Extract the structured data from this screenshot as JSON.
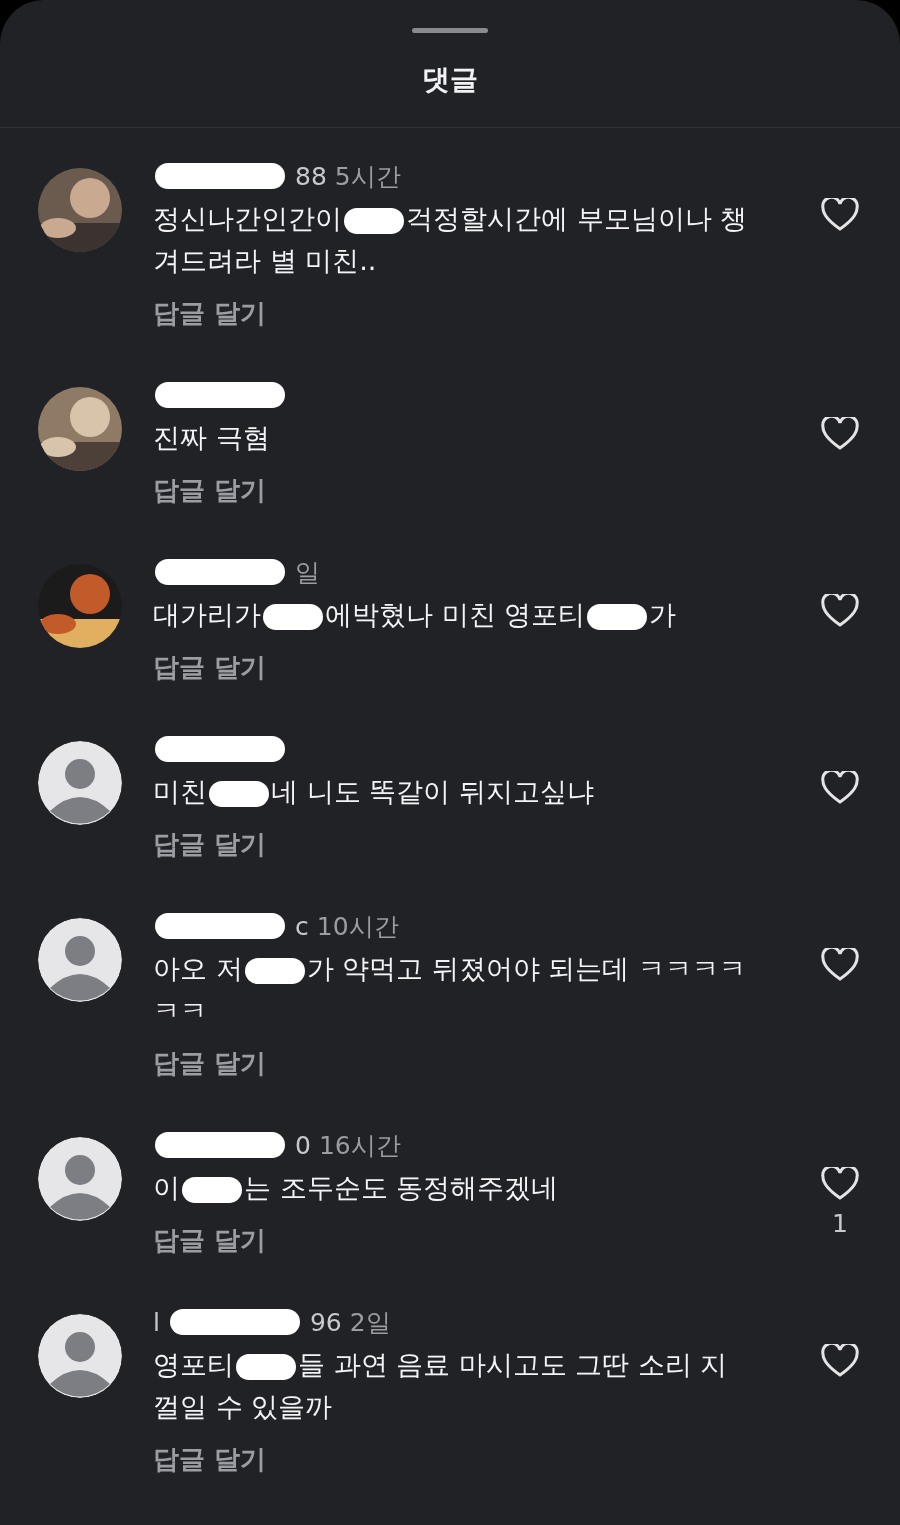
{
  "sheet": {
    "title": "댓글"
  },
  "comments": [
    {
      "user": [
        {
          "kind": "hidden"
        },
        {
          "kind": "text",
          "text": "88"
        }
      ],
      "time": "5시간",
      "text": [
        "정신나간인간이",
        "걱정할시간에 부모님이나 챙겨드려라 별 미친.."
      ],
      "reply": "답글 달기",
      "liked": false
    },
    {
      "user": [
        {
          "kind": "hidden"
        }
      ],
      "text": [
        "진짜 극혐"
      ],
      "reply": "답글 달기",
      "liked": false
    },
    {
      "user": [
        {
          "kind": "hidden"
        }
      ],
      "time": "일",
      "text": [
        "대가리가",
        "에박혔나 미친 영포티",
        "가"
      ],
      "reply": "답글 달기",
      "liked": false
    },
    {
      "kind": "default",
      "user": [
        {
          "kind": "hidden"
        }
      ],
      "text": [
        "미친",
        "네 니도 똑같이 뒤지고싶냐"
      ],
      "reply": "답글 달기",
      "liked": false
    },
    {
      "kind": "default",
      "user": [
        {
          "kind": "hidden"
        },
        {
          "kind": "text",
          "text": "c"
        }
      ],
      "time": "10시간",
      "text": [
        "아오 저",
        "가 약먹고 뒤졌어야 되는데 ㅋㅋㅋㅋㅋㅋ"
      ],
      "reply": "답글 달기",
      "liked": false
    },
    {
      "kind": "default",
      "user": [
        {
          "kind": "hidden"
        },
        {
          "kind": "text",
          "text": "0"
        }
      ],
      "time": "16시간",
      "text": [
        "이",
        "는 조두순도 동정해주겠네"
      ],
      "reply": "답글 달기",
      "liked": false,
      "likes": "1"
    },
    {
      "kind": "default",
      "user": [
        {
          "kind": "text",
          "text": "l"
        },
        {
          "kind": "hidden"
        },
        {
          "kind": "text",
          "text": "96"
        }
      ],
      "time": "2일",
      "text": [
        "영포티",
        "들 과연 음료 마시고도 그딴 소리 지껄일 수 있을까"
      ],
      "reply": "답글 달기",
      "liked": false
    }
  ]
}
